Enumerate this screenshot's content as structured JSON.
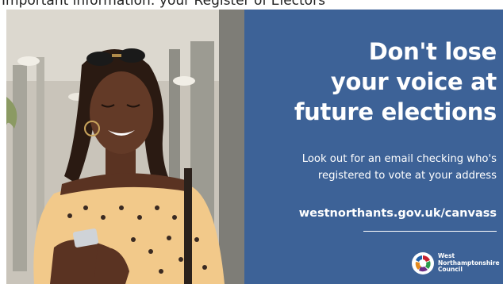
{
  "top_crop_text": "Important information: your Register of Electors",
  "panel": {
    "headline_lines": [
      "Don't lose",
      "your voice at",
      "future elections"
    ],
    "subtext_lines": [
      "Look out for an email checking who's",
      "registered to vote at your address"
    ],
    "url": "westnorthants.gov.uk/canvass",
    "logo_lines": [
      "West",
      "Northamptonshire",
      "Council"
    ]
  },
  "colors": {
    "panel_blue": "#3d6297",
    "text": "#ffffff",
    "dress_yellow": "#f2c98a",
    "skin": "#5a3322"
  },
  "icons": [
    "woman-photo",
    "council-logo-icon"
  ]
}
